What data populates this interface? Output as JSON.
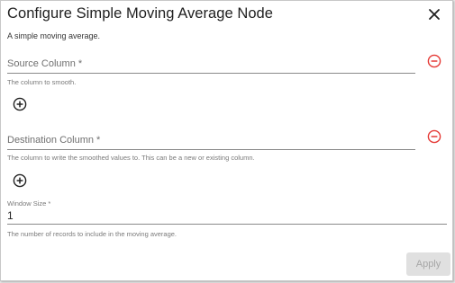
{
  "dialog": {
    "title": "Configure Simple Moving Average Node",
    "subtitle": "A simple moving average."
  },
  "fields": {
    "source": {
      "label": "Source Column *",
      "helper": "The column to smooth."
    },
    "destination": {
      "label": "Destination Column *",
      "helper": "The column to write the smoothed values to. This can be a new or existing column."
    },
    "window_size": {
      "label": "Window Size *",
      "value": "1",
      "helper": "The number of records to include in the moving average."
    }
  },
  "actions": {
    "apply_label": "Apply"
  },
  "colors": {
    "remove_icon": "#e53935",
    "add_icon": "#212121",
    "apply_disabled_bg": "#e0e0e0",
    "apply_disabled_text": "#a6a6a6"
  },
  "icons": {
    "close": "close-icon",
    "remove": "remove-circle-outline-icon",
    "add": "add-circle-outline-icon"
  }
}
